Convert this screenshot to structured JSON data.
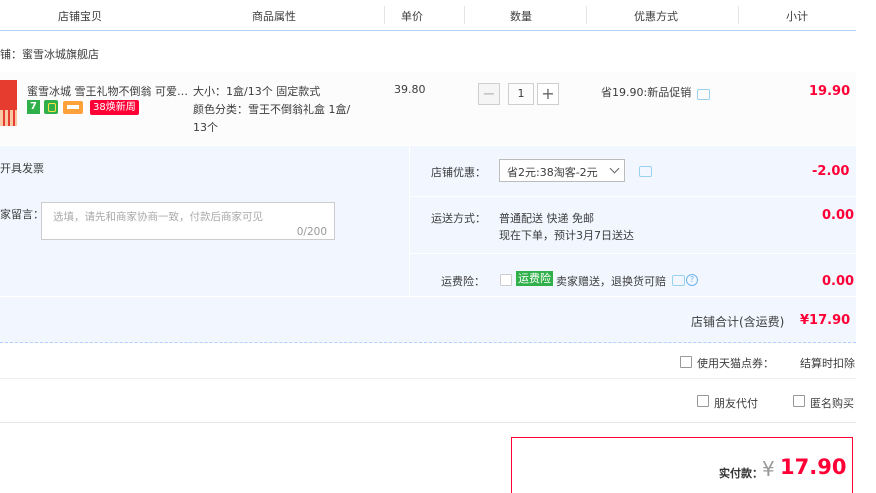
{
  "header": {
    "cols": [
      "店铺宝贝",
      "商品属性",
      "单价",
      "数量",
      "优惠方式",
      "小计"
    ]
  },
  "shop": {
    "label": "铺：蜜雪冰城旗舰店"
  },
  "item": {
    "title": "蜜雪冰城 雪王礼物不倒翁 可爱…",
    "badge7": "7",
    "promo_tag": "38焕新周",
    "attr_size": "大小：1盒/13个 固定款式",
    "attr_color": "颜色分类：雪王不倒翁礼盒 1盒/",
    "attr_color2": "13个",
    "price": "39.80",
    "qty": "1",
    "minus": "−",
    "plus": "+",
    "discount": "省19.90:新品促销",
    "subtotal": "19.90"
  },
  "invoice": {
    "label": "开具发票"
  },
  "message": {
    "label": "家留言：",
    "placeholder": "选填，请先和商家协商一致，付款后商家可见",
    "count": "0/200"
  },
  "coupon": {
    "label": "店铺优惠：",
    "selected": "省2元:38淘客-2元",
    "amount": "-2.00"
  },
  "shipping": {
    "label": "运送方式：",
    "method": "普通配送 快递 免邮",
    "eta": "现在下单，预计3月7日送达",
    "amount": "0.00"
  },
  "insurance": {
    "label": "运费险：",
    "tag": "运费险",
    "desc": "卖家赠送，退换货可赔",
    "help": "?",
    "amount": "0.00"
  },
  "shop_total": {
    "label": "店铺合计(含运费)",
    "amount": "¥17.90"
  },
  "tmall_points": {
    "label": "使用天猫点券：",
    "note": "结算时扣除"
  },
  "options": {
    "friend_pay": "朋友代付",
    "anonymous": "匿名购买"
  },
  "pay": {
    "label": "实付款：",
    "currency": "¥",
    "amount": "17.90"
  },
  "colors": {
    "accent": "#ff0036",
    "border_blue": "#b2d1ff",
    "panel_bg": "#f2f7ff"
  }
}
